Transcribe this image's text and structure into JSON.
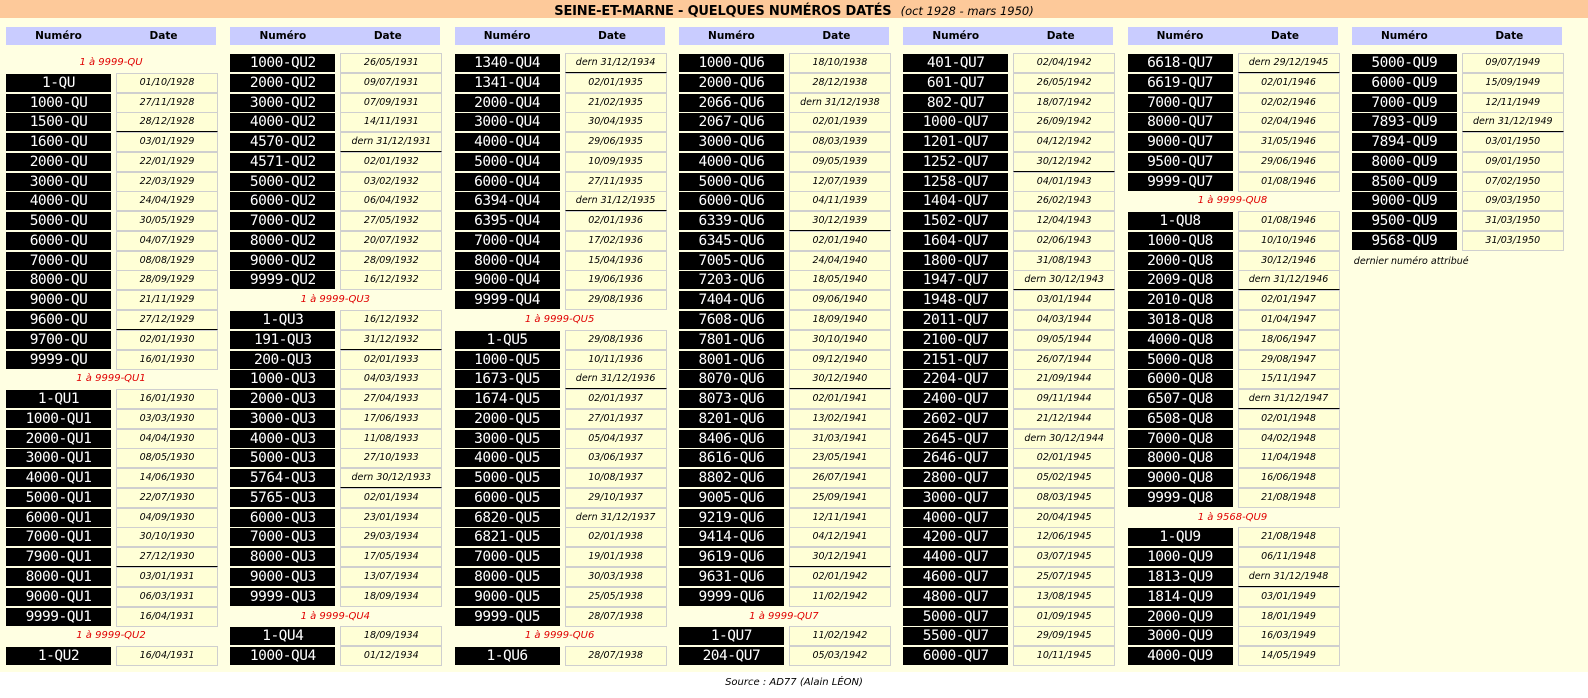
{
  "title": {
    "main": "SEINE-ET-MARNE - QUELQUES NUMÉROS DATÉS",
    "sub": "(oct 1928 - mars 1950)"
  },
  "headers": {
    "numero": "Numéro",
    "date": "Date"
  },
  "source": "Source : AD77 (Alain LÉON)",
  "columns": [
    {
      "items": [
        {
          "t": "s",
          "text": "1 à 9999-QU"
        },
        {
          "t": "r",
          "n": "1-QU",
          "d": "01/10/1928"
        },
        {
          "t": "r",
          "n": "1000-QU",
          "d": "27/11/1928"
        },
        {
          "t": "r",
          "n": "1500-QU",
          "d": "28/12/1928",
          "dern": true
        },
        {
          "t": "r",
          "n": "1600-QU",
          "d": "03/01/1929"
        },
        {
          "t": "r",
          "n": "2000-QU",
          "d": "22/01/1929"
        },
        {
          "t": "r",
          "n": "3000-QU",
          "d": "22/03/1929"
        },
        {
          "t": "r",
          "n": "4000-QU",
          "d": "24/04/1929"
        },
        {
          "t": "r",
          "n": "5000-QU",
          "d": "30/05/1929"
        },
        {
          "t": "r",
          "n": "6000-QU",
          "d": "04/07/1929"
        },
        {
          "t": "r",
          "n": "7000-QU",
          "d": "08/08/1929"
        },
        {
          "t": "r",
          "n": "8000-QU",
          "d": "28/09/1929"
        },
        {
          "t": "r",
          "n": "9000-QU",
          "d": "21/11/1929"
        },
        {
          "t": "r",
          "n": "9600-QU",
          "d": "27/12/1929",
          "dern": true
        },
        {
          "t": "r",
          "n": "9700-QU",
          "d": "02/01/1930"
        },
        {
          "t": "r",
          "n": "9999-QU",
          "d": "16/01/1930"
        },
        {
          "t": "s",
          "text": "1 à 9999-QU1"
        },
        {
          "t": "r",
          "n": "1-QU1",
          "d": "16/01/1930"
        },
        {
          "t": "r",
          "n": "1000-QU1",
          "d": "03/03/1930"
        },
        {
          "t": "r",
          "n": "2000-QU1",
          "d": "04/04/1930"
        },
        {
          "t": "r",
          "n": "3000-QU1",
          "d": "08/05/1930"
        },
        {
          "t": "r",
          "n": "4000-QU1",
          "d": "14/06/1930"
        },
        {
          "t": "r",
          "n": "5000-QU1",
          "d": "22/07/1930"
        },
        {
          "t": "r",
          "n": "6000-QU1",
          "d": "04/09/1930"
        },
        {
          "t": "r",
          "n": "7000-QU1",
          "d": "30/10/1930"
        },
        {
          "t": "r",
          "n": "7900-QU1",
          "d": "27/12/1930",
          "dern": true
        },
        {
          "t": "r",
          "n": "8000-QU1",
          "d": "03/01/1931"
        },
        {
          "t": "r",
          "n": "9000-QU1",
          "d": "06/03/1931"
        },
        {
          "t": "r",
          "n": "9999-QU1",
          "d": "16/04/1931"
        },
        {
          "t": "s",
          "text": "1 à 9999-QU2"
        },
        {
          "t": "r",
          "n": "1-QU2",
          "d": "16/04/1931"
        }
      ]
    },
    {
      "items": [
        {
          "t": "r",
          "n": "1000-QU2",
          "d": "26/05/1931"
        },
        {
          "t": "r",
          "n": "2000-QU2",
          "d": "09/07/1931"
        },
        {
          "t": "r",
          "n": "3000-QU2",
          "d": "07/09/1931"
        },
        {
          "t": "r",
          "n": "4000-QU2",
          "d": "14/11/1931"
        },
        {
          "t": "r",
          "n": "4570-QU2",
          "d": "dern 31/12/1931",
          "dern": true
        },
        {
          "t": "r",
          "n": "4571-QU2",
          "d": "02/01/1932"
        },
        {
          "t": "r",
          "n": "5000-QU2",
          "d": "03/02/1932"
        },
        {
          "t": "r",
          "n": "6000-QU2",
          "d": "06/04/1932"
        },
        {
          "t": "r",
          "n": "7000-QU2",
          "d": "27/05/1932"
        },
        {
          "t": "r",
          "n": "8000-QU2",
          "d": "20/07/1932"
        },
        {
          "t": "r",
          "n": "9000-QU2",
          "d": "28/09/1932"
        },
        {
          "t": "r",
          "n": "9999-QU2",
          "d": "16/12/1932"
        },
        {
          "t": "s",
          "text": "1 à 9999-QU3"
        },
        {
          "t": "r",
          "n": "1-QU3",
          "d": "16/12/1932"
        },
        {
          "t": "r",
          "n": "191-QU3",
          "d": "31/12/1932",
          "dern": true
        },
        {
          "t": "r",
          "n": "200-QU3",
          "d": "02/01/1933"
        },
        {
          "t": "r",
          "n": "1000-QU3",
          "d": "04/03/1933"
        },
        {
          "t": "r",
          "n": "2000-QU3",
          "d": "27/04/1933"
        },
        {
          "t": "r",
          "n": "3000-QU3",
          "d": "17/06/1933"
        },
        {
          "t": "r",
          "n": "4000-QU3",
          "d": "11/08/1933"
        },
        {
          "t": "r",
          "n": "5000-QU3",
          "d": "27/10/1933"
        },
        {
          "t": "r",
          "n": "5764-QU3",
          "d": "dern 30/12/1933",
          "dern": true
        },
        {
          "t": "r",
          "n": "5765-QU3",
          "d": "02/01/1934"
        },
        {
          "t": "r",
          "n": "6000-QU3",
          "d": "23/01/1934"
        },
        {
          "t": "r",
          "n": "7000-QU3",
          "d": "29/03/1934"
        },
        {
          "t": "r",
          "n": "8000-QU3",
          "d": "17/05/1934"
        },
        {
          "t": "r",
          "n": "9000-QU3",
          "d": "13/07/1934"
        },
        {
          "t": "r",
          "n": "9999-QU3",
          "d": "18/09/1934"
        },
        {
          "t": "s",
          "text": "1 à 9999-QU4"
        },
        {
          "t": "r",
          "n": "1-QU4",
          "d": "18/09/1934"
        },
        {
          "t": "r",
          "n": "1000-QU4",
          "d": "01/12/1934"
        }
      ]
    },
    {
      "items": [
        {
          "t": "r",
          "n": "1340-QU4",
          "d": "dern 31/12/1934",
          "dern": true
        },
        {
          "t": "r",
          "n": "1341-QU4",
          "d": "02/01/1935"
        },
        {
          "t": "r",
          "n": "2000-QU4",
          "d": "21/02/1935"
        },
        {
          "t": "r",
          "n": "3000-QU4",
          "d": "30/04/1935"
        },
        {
          "t": "r",
          "n": "4000-QU4",
          "d": "29/06/1935"
        },
        {
          "t": "r",
          "n": "5000-QU4",
          "d": "10/09/1935"
        },
        {
          "t": "r",
          "n": "6000-QU4",
          "d": "27/11/1935"
        },
        {
          "t": "r",
          "n": "6394-QU4",
          "d": "dern 31/12/1935",
          "dern": true
        },
        {
          "t": "r",
          "n": "6395-QU4",
          "d": "02/01/1936"
        },
        {
          "t": "r",
          "n": "7000-QU4",
          "d": "17/02/1936"
        },
        {
          "t": "r",
          "n": "8000-QU4",
          "d": "15/04/1936"
        },
        {
          "t": "r",
          "n": "9000-QU4",
          "d": "19/06/1936"
        },
        {
          "t": "r",
          "n": "9999-QU4",
          "d": "29/08/1936"
        },
        {
          "t": "s",
          "text": "1 à 9999-QU5"
        },
        {
          "t": "r",
          "n": "1-QU5",
          "d": "29/08/1936"
        },
        {
          "t": "r",
          "n": "1000-QU5",
          "d": "10/11/1936"
        },
        {
          "t": "r",
          "n": "1673-QU5",
          "d": "dern 31/12/1936",
          "dern": true
        },
        {
          "t": "r",
          "n": "1674-QU5",
          "d": "02/01/1937"
        },
        {
          "t": "r",
          "n": "2000-QU5",
          "d": "27/01/1937"
        },
        {
          "t": "r",
          "n": "3000-QU5",
          "d": "05/04/1937"
        },
        {
          "t": "r",
          "n": "4000-QU5",
          "d": "03/06/1937"
        },
        {
          "t": "r",
          "n": "5000-QU5",
          "d": "10/08/1937"
        },
        {
          "t": "r",
          "n": "6000-QU5",
          "d": "29/10/1937"
        },
        {
          "t": "r",
          "n": "6820-QU5",
          "d": "dern 31/12/1937",
          "dern": true
        },
        {
          "t": "r",
          "n": "6821-QU5",
          "d": "02/01/1938"
        },
        {
          "t": "r",
          "n": "7000-QU5",
          "d": "19/01/1938"
        },
        {
          "t": "r",
          "n": "8000-QU5",
          "d": "30/03/1938"
        },
        {
          "t": "r",
          "n": "9000-QU5",
          "d": "25/05/1938"
        },
        {
          "t": "r",
          "n": "9999-QU5",
          "d": "28/07/1938"
        },
        {
          "t": "s",
          "text": "1 à 9999-QU6"
        },
        {
          "t": "r",
          "n": "1-QU6",
          "d": "28/07/1938"
        }
      ]
    },
    {
      "items": [
        {
          "t": "r",
          "n": "1000-QU6",
          "d": "18/10/1938"
        },
        {
          "t": "r",
          "n": "2000-QU6",
          "d": "28/12/1938"
        },
        {
          "t": "r",
          "n": "2066-QU6",
          "d": "dern 31/12/1938",
          "dern": true
        },
        {
          "t": "r",
          "n": "2067-QU6",
          "d": "02/01/1939"
        },
        {
          "t": "r",
          "n": "3000-QU6",
          "d": "08/03/1939"
        },
        {
          "t": "r",
          "n": "4000-QU6",
          "d": "09/05/1939"
        },
        {
          "t": "r",
          "n": "5000-QU6",
          "d": "12/07/1939"
        },
        {
          "t": "r",
          "n": "6000-QU6",
          "d": "04/11/1939"
        },
        {
          "t": "r",
          "n": "6339-QU6",
          "d": "30/12/1939",
          "dern": true
        },
        {
          "t": "r",
          "n": "6345-QU6",
          "d": "02/01/1940"
        },
        {
          "t": "r",
          "n": "7005-QU6",
          "d": "24/04/1940"
        },
        {
          "t": "r",
          "n": "7203-QU6",
          "d": "18/05/1940"
        },
        {
          "t": "r",
          "n": "7404-QU6",
          "d": "09/06/1940"
        },
        {
          "t": "r",
          "n": "7608-QU6",
          "d": "18/09/1940"
        },
        {
          "t": "r",
          "n": "7801-QU6",
          "d": "30/10/1940"
        },
        {
          "t": "r",
          "n": "8001-QU6",
          "d": "09/12/1940"
        },
        {
          "t": "r",
          "n": "8070-QU6",
          "d": "30/12/1940",
          "dern": true
        },
        {
          "t": "r",
          "n": "8073-QU6",
          "d": "02/01/1941"
        },
        {
          "t": "r",
          "n": "8201-QU6",
          "d": "13/02/1941"
        },
        {
          "t": "r",
          "n": "8406-QU6",
          "d": "31/03/1941"
        },
        {
          "t": "r",
          "n": "8616-QU6",
          "d": "23/05/1941"
        },
        {
          "t": "r",
          "n": "8802-QU6",
          "d": "26/07/1941"
        },
        {
          "t": "r",
          "n": "9005-QU6",
          "d": "25/09/1941"
        },
        {
          "t": "r",
          "n": "9219-QU6",
          "d": "12/11/1941"
        },
        {
          "t": "r",
          "n": "9414-QU6",
          "d": "04/12/1941"
        },
        {
          "t": "r",
          "n": "9619-QU6",
          "d": "30/12/1941",
          "dern": true
        },
        {
          "t": "r",
          "n": "9631-QU6",
          "d": "02/01/1942"
        },
        {
          "t": "r",
          "n": "9999-QU6",
          "d": "11/02/1942"
        },
        {
          "t": "s",
          "text": "1 à 9999-QU7"
        },
        {
          "t": "r",
          "n": "1-QU7",
          "d": "11/02/1942"
        },
        {
          "t": "r",
          "n": "204-QU7",
          "d": "05/03/1942"
        }
      ]
    },
    {
      "items": [
        {
          "t": "r",
          "n": "401-QU7",
          "d": "02/04/1942"
        },
        {
          "t": "r",
          "n": "601-QU7",
          "d": "26/05/1942"
        },
        {
          "t": "r",
          "n": "802-QU7",
          "d": "18/07/1942"
        },
        {
          "t": "r",
          "n": "1000-QU7",
          "d": "26/09/1942"
        },
        {
          "t": "r",
          "n": "1201-QU7",
          "d": "04/12/1942"
        },
        {
          "t": "r",
          "n": "1252-QU7",
          "d": "30/12/1942",
          "dern": true
        },
        {
          "t": "r",
          "n": "1258-QU7",
          "d": "04/01/1943"
        },
        {
          "t": "r",
          "n": "1404-QU7",
          "d": "26/02/1943"
        },
        {
          "t": "r",
          "n": "1502-QU7",
          "d": "12/04/1943"
        },
        {
          "t": "r",
          "n": "1604-QU7",
          "d": "02/06/1943"
        },
        {
          "t": "r",
          "n": "1800-QU7",
          "d": "31/08/1943"
        },
        {
          "t": "r",
          "n": "1947-QU7",
          "d": "dern 30/12/1943",
          "dern": true
        },
        {
          "t": "r",
          "n": "1948-QU7",
          "d": "03/01/1944"
        },
        {
          "t": "r",
          "n": "2011-QU7",
          "d": "04/03/1944"
        },
        {
          "t": "r",
          "n": "2100-QU7",
          "d": "09/05/1944"
        },
        {
          "t": "r",
          "n": "2151-QU7",
          "d": "26/07/1944"
        },
        {
          "t": "r",
          "n": "2204-QU7",
          "d": "21/09/1944"
        },
        {
          "t": "r",
          "n": "2400-QU7",
          "d": "09/11/1944"
        },
        {
          "t": "r",
          "n": "2602-QU7",
          "d": "21/12/1944"
        },
        {
          "t": "r",
          "n": "2645-QU7",
          "d": "dern 30/12/1944",
          "dern": true
        },
        {
          "t": "r",
          "n": "2646-QU7",
          "d": "02/01/1945"
        },
        {
          "t": "r",
          "n": "2800-QU7",
          "d": "05/02/1945"
        },
        {
          "t": "r",
          "n": "3000-QU7",
          "d": "08/03/1945"
        },
        {
          "t": "r",
          "n": "4000-QU7",
          "d": "20/04/1945"
        },
        {
          "t": "r",
          "n": "4200-QU7",
          "d": "12/06/1945"
        },
        {
          "t": "r",
          "n": "4400-QU7",
          "d": "03/07/1945"
        },
        {
          "t": "r",
          "n": "4600-QU7",
          "d": "25/07/1945"
        },
        {
          "t": "r",
          "n": "4800-QU7",
          "d": "13/08/1945"
        },
        {
          "t": "r",
          "n": "5000-QU7",
          "d": "01/09/1945"
        },
        {
          "t": "r",
          "n": "5500-QU7",
          "d": "29/09/1945"
        },
        {
          "t": "r",
          "n": "6000-QU7",
          "d": "10/11/1945"
        }
      ]
    },
    {
      "items": [
        {
          "t": "r",
          "n": "6618-QU7",
          "d": "dern 29/12/1945",
          "dern": true
        },
        {
          "t": "r",
          "n": "6619-QU7",
          "d": "02/01/1946"
        },
        {
          "t": "r",
          "n": "7000-QU7",
          "d": "02/02/1946"
        },
        {
          "t": "r",
          "n": "8000-QU7",
          "d": "02/04/1946"
        },
        {
          "t": "r",
          "n": "9000-QU7",
          "d": "31/05/1946"
        },
        {
          "t": "r",
          "n": "9500-QU7",
          "d": "29/06/1946"
        },
        {
          "t": "r",
          "n": "9999-QU7",
          "d": "01/08/1946"
        },
        {
          "t": "s",
          "text": "1 à 9999-QU8"
        },
        {
          "t": "r",
          "n": "1-QU8",
          "d": "01/08/1946"
        },
        {
          "t": "r",
          "n": "1000-QU8",
          "d": "10/10/1946"
        },
        {
          "t": "r",
          "n": "2000-QU8",
          "d": "30/12/1946"
        },
        {
          "t": "r",
          "n": "2009-QU8",
          "d": "dern 31/12/1946",
          "dern": true
        },
        {
          "t": "r",
          "n": "2010-QU8",
          "d": "02/01/1947"
        },
        {
          "t": "r",
          "n": "3018-QU8",
          "d": "01/04/1947"
        },
        {
          "t": "r",
          "n": "4000-QU8",
          "d": "18/06/1947"
        },
        {
          "t": "r",
          "n": "5000-QU8",
          "d": "29/08/1947"
        },
        {
          "t": "r",
          "n": "6000-QU8",
          "d": "15/11/1947"
        },
        {
          "t": "r",
          "n": "6507-QU8",
          "d": "dern 31/12/1947",
          "dern": true
        },
        {
          "t": "r",
          "n": "6508-QU8",
          "d": "02/01/1948"
        },
        {
          "t": "r",
          "n": "7000-QU8",
          "d": "04/02/1948"
        },
        {
          "t": "r",
          "n": "8000-QU8",
          "d": "11/04/1948"
        },
        {
          "t": "r",
          "n": "9000-QU8",
          "d": "16/06/1948"
        },
        {
          "t": "r",
          "n": "9999-QU8",
          "d": "21/08/1948"
        },
        {
          "t": "s",
          "text": "1 à 9568-QU9"
        },
        {
          "t": "r",
          "n": "1-QU9",
          "d": "21/08/1948"
        },
        {
          "t": "r",
          "n": "1000-QU9",
          "d": "06/11/1948"
        },
        {
          "t": "r",
          "n": "1813-QU9",
          "d": "dern 31/12/1948",
          "dern": true
        },
        {
          "t": "r",
          "n": "1814-QU9",
          "d": "03/01/1949"
        },
        {
          "t": "r",
          "n": "2000-QU9",
          "d": "18/01/1949"
        },
        {
          "t": "r",
          "n": "3000-QU9",
          "d": "16/03/1949"
        },
        {
          "t": "r",
          "n": "4000-QU9",
          "d": "14/05/1949"
        }
      ]
    },
    {
      "items": [
        {
          "t": "r",
          "n": "5000-QU9",
          "d": "09/07/1949"
        },
        {
          "t": "r",
          "n": "6000-QU9",
          "d": "15/09/1949"
        },
        {
          "t": "r",
          "n": "7000-QU9",
          "d": "12/11/1949"
        },
        {
          "t": "r",
          "n": "7893-QU9",
          "d": "dern 31/12/1949",
          "dern": true
        },
        {
          "t": "r",
          "n": "7894-QU9",
          "d": "03/01/1950"
        },
        {
          "t": "r",
          "n": "8000-QU9",
          "d": "09/01/1950"
        },
        {
          "t": "r",
          "n": "8500-QU9",
          "d": "07/02/1950"
        },
        {
          "t": "r",
          "n": "9000-QU9",
          "d": "09/03/1950"
        },
        {
          "t": "r",
          "n": "9500-QU9",
          "d": "31/03/1950"
        },
        {
          "t": "r",
          "n": "9568-QU9",
          "d": "31/03/1950"
        }
      ],
      "note": "dernier numéro attribué"
    }
  ]
}
